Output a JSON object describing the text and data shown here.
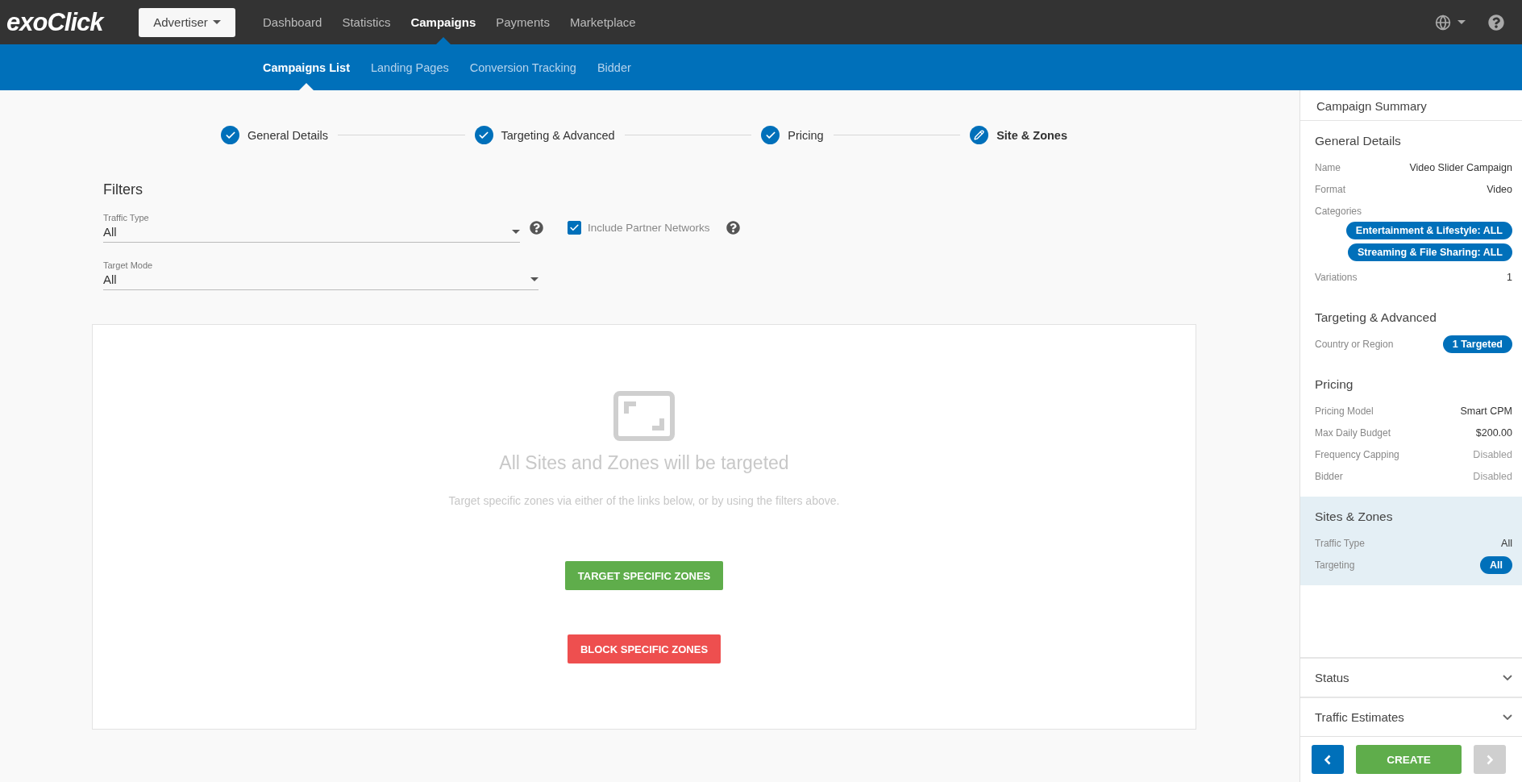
{
  "logo": {
    "text": "exoClick"
  },
  "account_menu": {
    "label": "Advertiser"
  },
  "main_nav": [
    {
      "label": "Dashboard",
      "selected": false
    },
    {
      "label": "Statistics",
      "selected": false
    },
    {
      "label": "Campaigns",
      "selected": true
    },
    {
      "label": "Payments",
      "selected": false
    },
    {
      "label": "Marketplace",
      "selected": false
    }
  ],
  "sub_nav": [
    {
      "label": "Campaigns List",
      "selected": true
    },
    {
      "label": "Landing Pages",
      "selected": false
    },
    {
      "label": "Conversion Tracking",
      "selected": false
    },
    {
      "label": "Bidder",
      "selected": false
    }
  ],
  "steps": [
    {
      "label": "General Details",
      "completed": true
    },
    {
      "label": "Targeting & Advanced",
      "completed": true
    },
    {
      "label": "Pricing",
      "completed": true
    },
    {
      "label": "Site & Zones",
      "completed": false
    }
  ],
  "filters": {
    "title": "Filters",
    "traffic_type": {
      "label": "Traffic Type",
      "value": "All"
    },
    "include_partner_networks": {
      "label": "Include Partner Networks",
      "checked": true
    },
    "target_mode": {
      "label": "Target Mode",
      "value": "All"
    }
  },
  "empty_state": {
    "title": "All Sites and Zones will be targeted",
    "text": "Target specific zones via either of the links below, or by using the filters above.",
    "buttons": [
      {
        "label": "TARGET SPECIFIC ZONES",
        "kind": "target"
      },
      {
        "label": "BLOCK SPECIFIC ZONES",
        "kind": "block"
      }
    ]
  },
  "summary": {
    "title": "Campaign Summary",
    "sections": [
      {
        "title": "General Details",
        "highlighted": false,
        "rows": [
          {
            "kind": "text",
            "label": "Name",
            "value": "Video Slider Campaign"
          },
          {
            "kind": "text",
            "label": "Format",
            "value": "Video"
          },
          {
            "kind": "tags",
            "label": "Categories",
            "tags": [
              "Entertainment & Lifestyle: ALL",
              "Streaming & File Sharing: ALL"
            ]
          },
          {
            "kind": "text",
            "label": "Variations",
            "value": "1"
          }
        ]
      },
      {
        "title": "Targeting & Advanced",
        "highlighted": false,
        "rows": [
          {
            "kind": "tag",
            "label": "Country or Region",
            "value": "1 Targeted"
          }
        ]
      },
      {
        "title": "Pricing",
        "highlighted": false,
        "rows": [
          {
            "kind": "text",
            "label": "Pricing Model",
            "value": "Smart CPM"
          },
          {
            "kind": "text",
            "label": "Max Daily Budget",
            "value": "$200.00"
          },
          {
            "kind": "muted",
            "label": "Frequency Capping",
            "value": "Disabled"
          },
          {
            "kind": "muted",
            "label": "Bidder",
            "value": "Disabled"
          }
        ]
      },
      {
        "title": "Sites & Zones",
        "highlighted": true,
        "rows": [
          {
            "kind": "text",
            "label": "Traffic Type",
            "value": "All"
          },
          {
            "kind": "tag",
            "label": "Targeting",
            "value": "All"
          }
        ]
      }
    ]
  },
  "collapsibles": [
    {
      "title": "Status",
      "expanded": false
    },
    {
      "title": "Traffic Estimates",
      "expanded": false
    }
  ],
  "footer": {
    "back": {
      "disabled": false
    },
    "create": {
      "label": "CREATE"
    },
    "next": {
      "disabled": true
    }
  }
}
